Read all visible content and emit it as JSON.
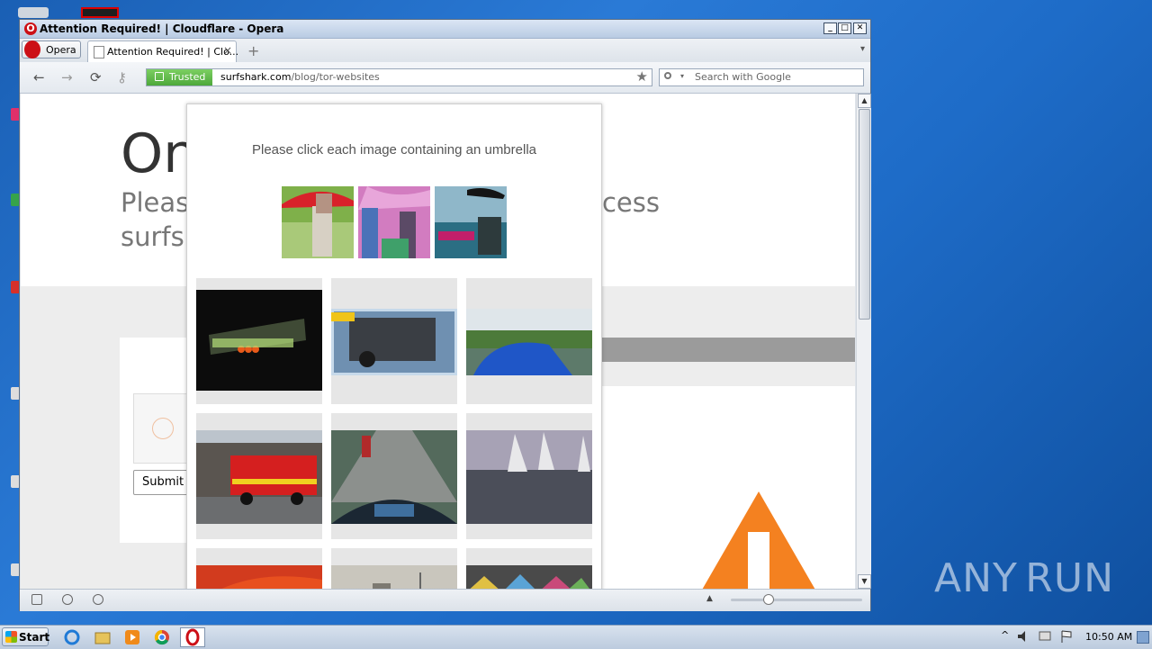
{
  "window": {
    "title": "Attention Required! | Cloudflare - Opera",
    "min_glyph": "_",
    "max_glyph": "□",
    "close_glyph": "✕"
  },
  "tabbar": {
    "menu_label": "Opera",
    "tab_label": "Attention Required! | Clo...",
    "tab_close": "×",
    "new_tab": "+",
    "dropdown": "▾"
  },
  "toolbar": {
    "back": "←",
    "forward": "→",
    "reload": "⟳",
    "key": "⚷",
    "trusted_label": "Trusted",
    "url_host": "surfshark.com",
    "url_path": "/blog/tor-websites",
    "bookmark": "★",
    "search_dropdown": "▾",
    "search_placeholder": "Search with Google"
  },
  "page": {
    "heading": "On",
    "sub_line1": "Pleas",
    "sub_line2": "surfsh",
    "access_text": "ccess",
    "submit_label": "Submit"
  },
  "captcha": {
    "prompt": "Please click each image containing an umbrella",
    "tiles": [
      {
        "id": 1,
        "color": "#111111"
      },
      {
        "id": 2,
        "color": "#4a5e70"
      },
      {
        "id": 3,
        "color": "#3b6b9a"
      },
      {
        "id": 4,
        "color": "#7a6d63"
      },
      {
        "id": 5,
        "color": "#4f5a55"
      },
      {
        "id": 6,
        "color": "#6a6e7a"
      },
      {
        "id": 7,
        "color": "#d23b1e"
      },
      {
        "id": 8,
        "color": "#b9b4a6"
      },
      {
        "id": 9,
        "color": "#5c5a70"
      }
    ]
  },
  "scrollbar": {
    "up": "▲",
    "down": "▼"
  },
  "statusbar": {
    "zoom_up": "▲"
  },
  "taskbar": {
    "start_label": "Start",
    "clock": "10:50 AM",
    "tray_up": "^"
  },
  "watermark": {
    "left": "ANY",
    "right": "RUN"
  }
}
